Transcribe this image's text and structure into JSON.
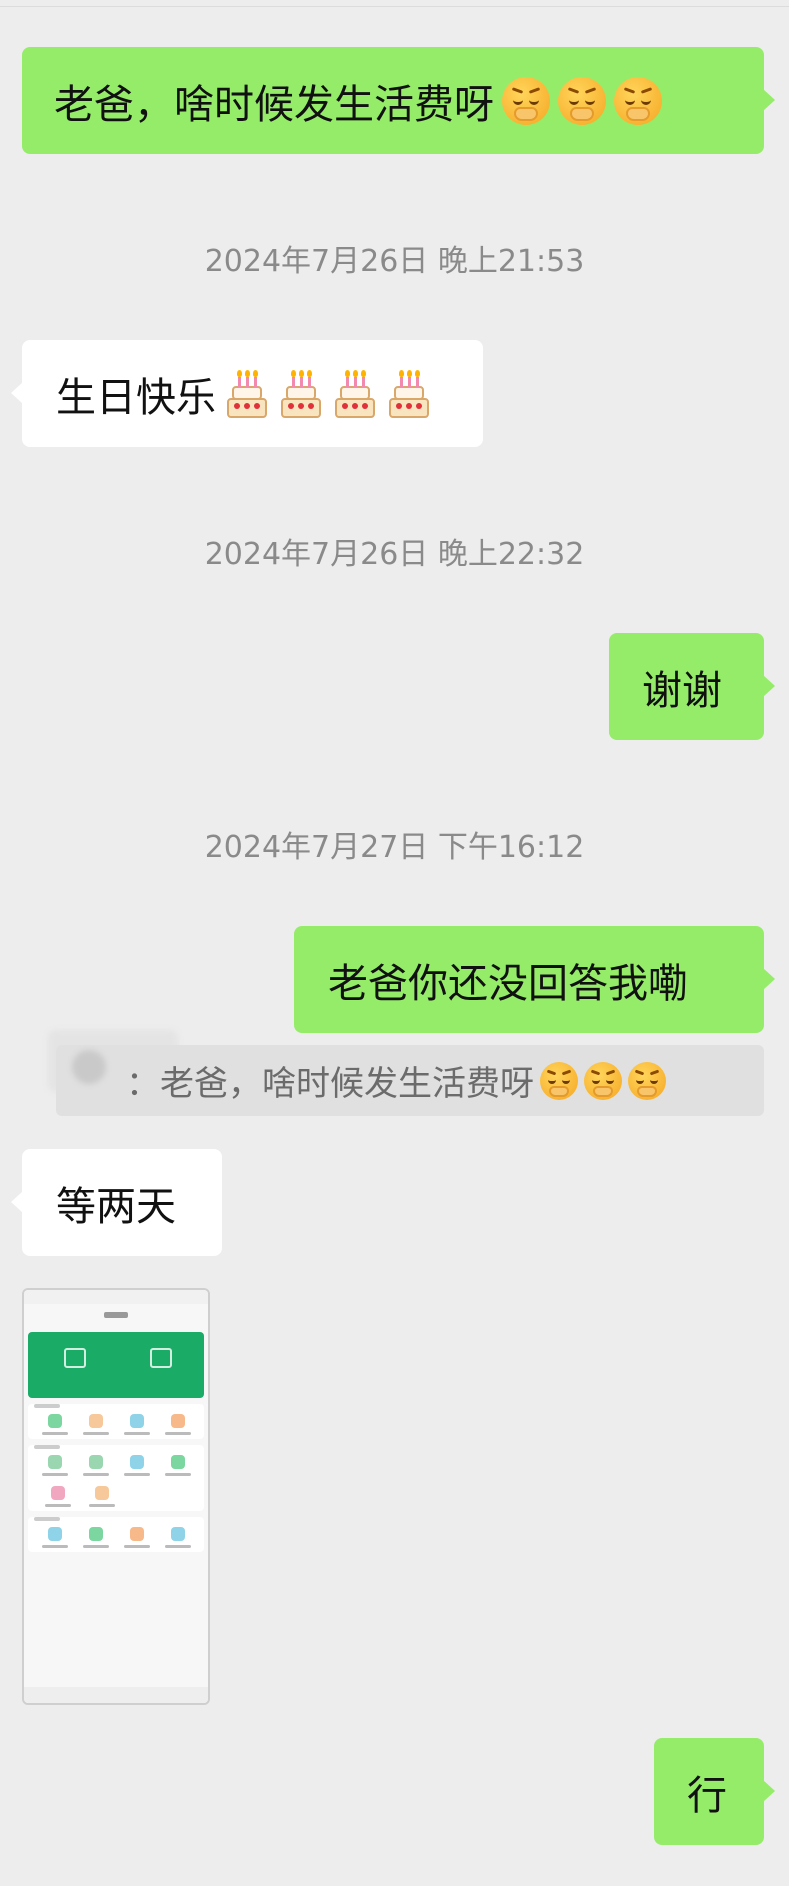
{
  "messages": [
    {
      "text": "老爸，啥时候发生活费呀"
    },
    {
      "timestamp": "2024年7月26日 晚上21:53"
    },
    {
      "text": "生日快乐"
    },
    {
      "timestamp": "2024年7月26日 晚上22:32"
    },
    {
      "text": "谢谢"
    },
    {
      "timestamp": "2024年7月27日 下午16:12"
    },
    {
      "text": "老爸你还没回答我嘞"
    },
    {
      "quote": "：老爸，啥时候发生活费呀"
    },
    {
      "text": "等两天"
    },
    {
      "text": "行"
    }
  ],
  "emoji": {
    "sad": "hand-over-mouth-sad-emoji",
    "cake": "birthday-cake-emoji"
  },
  "colors": {
    "background": "#ededed",
    "outgoing_bubble": "#95ec69",
    "incoming_bubble": "#ffffff",
    "timestamp_text": "#8a8a8a",
    "thumbnail_accent": "#1aab66"
  }
}
